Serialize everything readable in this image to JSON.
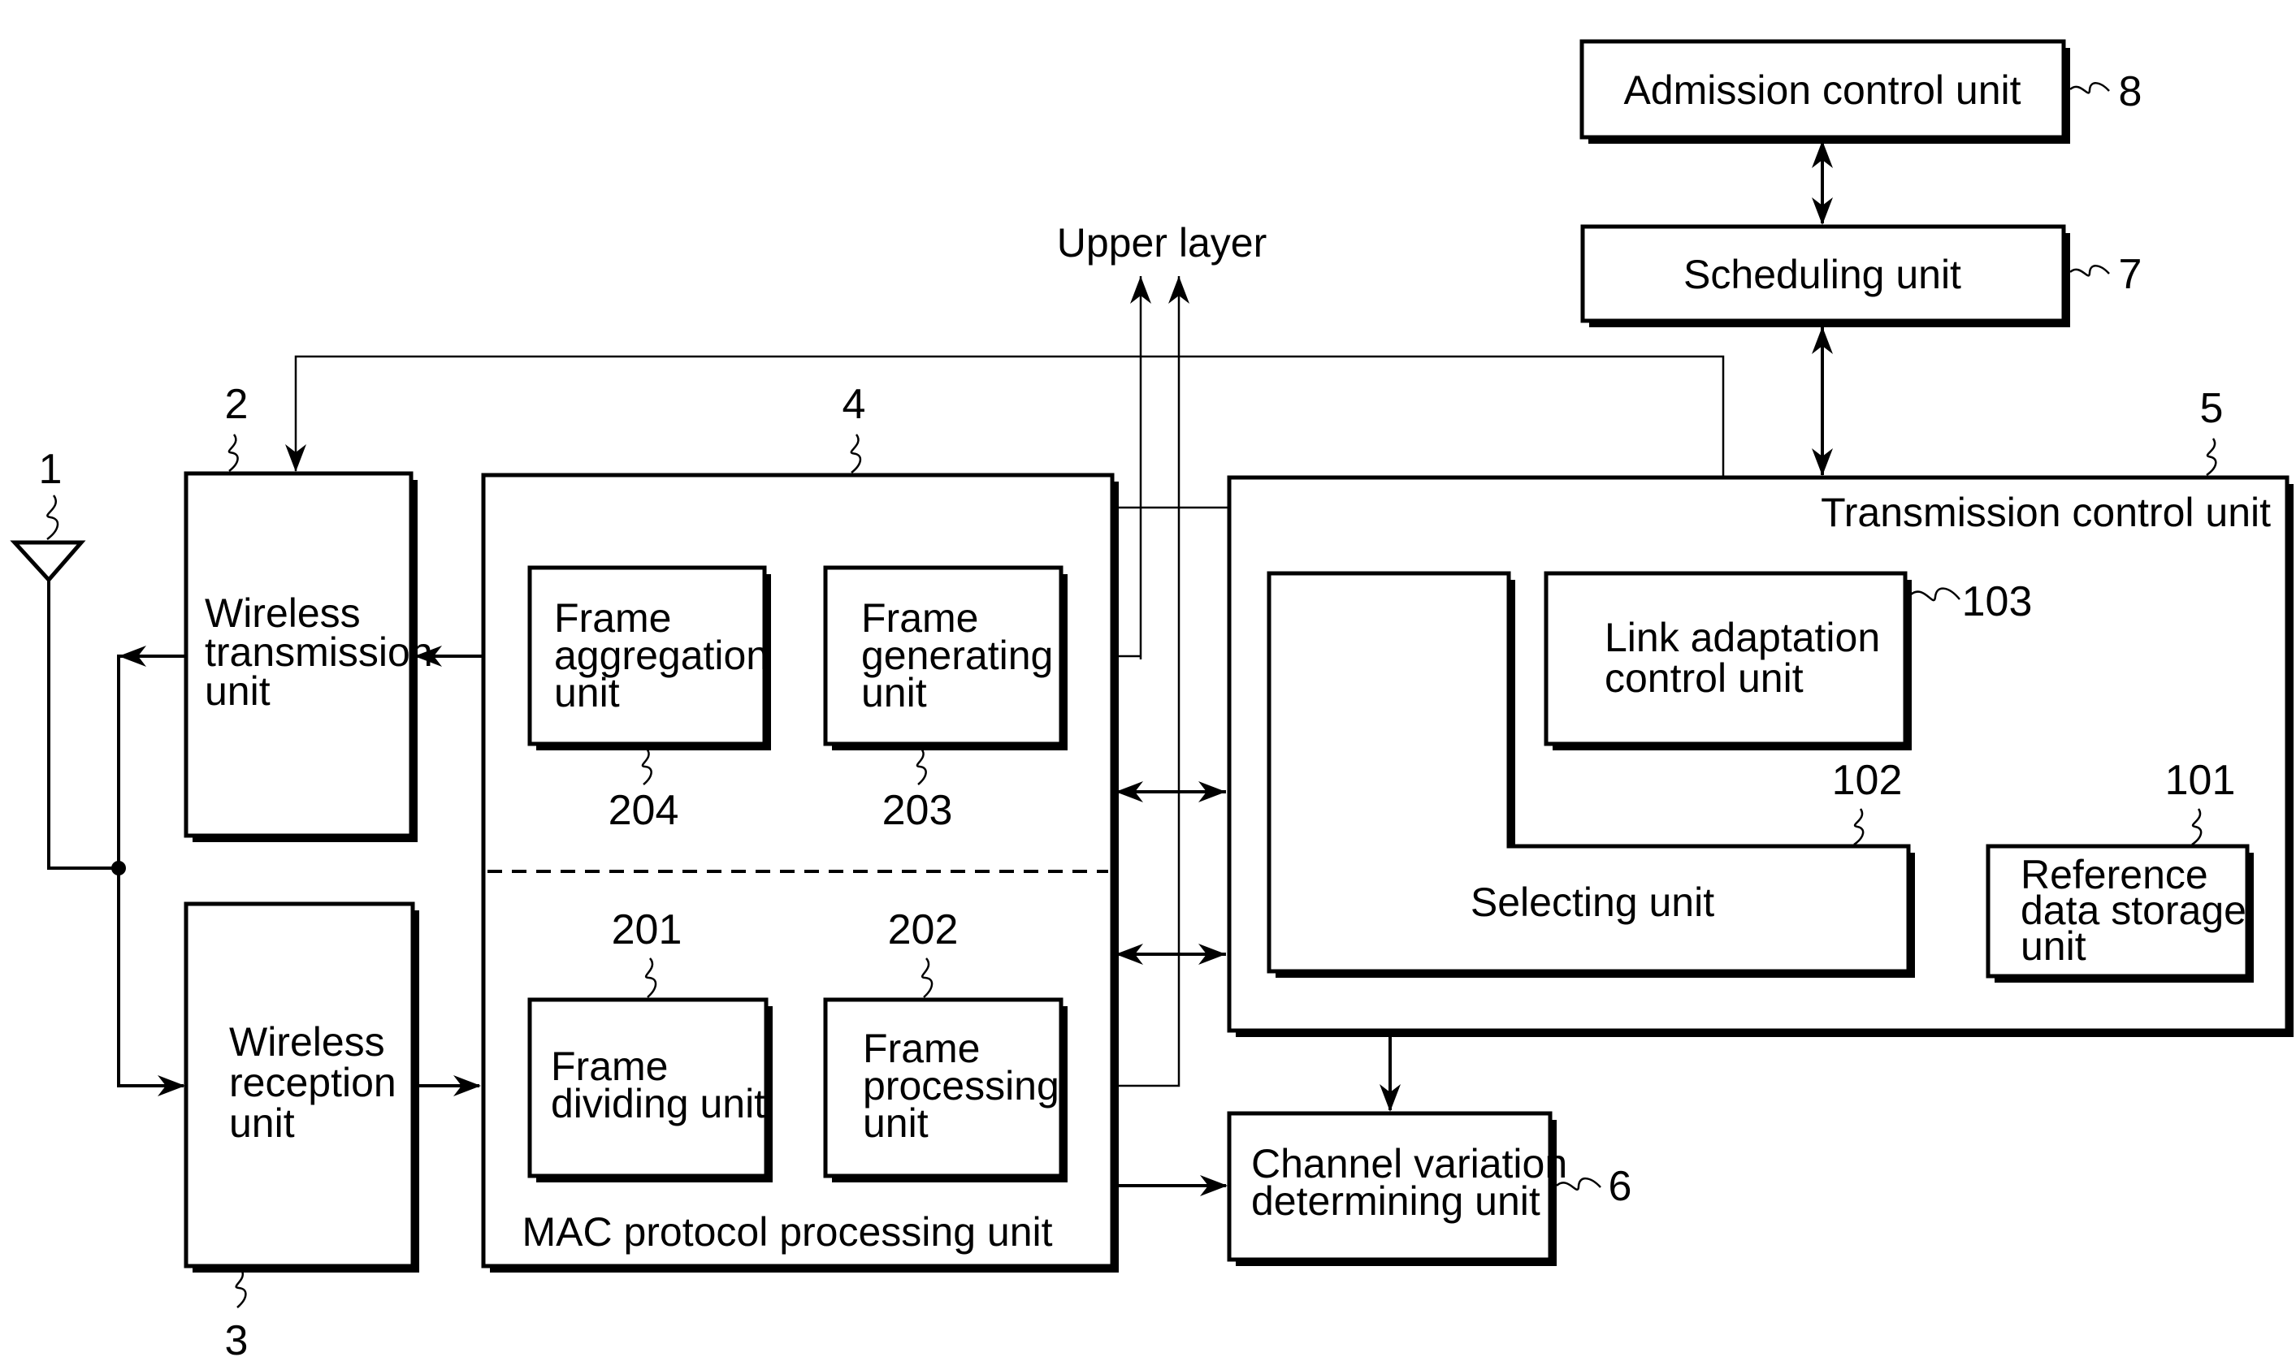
{
  "figure": {
    "upper_layer": "Upper layer",
    "blocks": {
      "admission": {
        "lines": [
          "Admission  control  unit"
        ],
        "ref": "8"
      },
      "scheduling": {
        "lines": [
          "Scheduling  unit"
        ],
        "ref": "7"
      },
      "wireless_tx": {
        "lines": [
          "Wireless",
          "transmission",
          "unit"
        ],
        "ref": "2"
      },
      "wireless_rx": {
        "lines": [
          "Wireless",
          "reception",
          "unit"
        ],
        "ref": "3"
      },
      "antenna": {
        "ref": "1"
      },
      "mac": {
        "lines": [
          "MAC  protocol  processing  unit"
        ],
        "ref": "4"
      },
      "frame_aggregation": {
        "lines": [
          "Frame",
          "aggregation",
          "unit"
        ],
        "ref": "204"
      },
      "frame_generating": {
        "lines": [
          "Frame",
          "generating",
          "unit"
        ],
        "ref": "203"
      },
      "frame_dividing": {
        "lines": [
          "Frame",
          "dividing  unit"
        ],
        "ref": "201"
      },
      "frame_processing": {
        "lines": [
          "Frame",
          "processing",
          "unit"
        ],
        "ref": "202"
      },
      "transmission_control": {
        "lines": [
          "Transmission  control  unit"
        ],
        "ref": "5"
      },
      "link_adaptation": {
        "lines": [
          "Link  adaptation",
          "control  unit"
        ],
        "ref": "103"
      },
      "selecting": {
        "lines": [
          "Selecting  unit"
        ],
        "ref": "102"
      },
      "reference_data": {
        "lines": [
          "Reference",
          "data  storage",
          "unit"
        ],
        "ref": "101"
      },
      "channel_variation": {
        "lines": [
          "Channel  variation",
          "determining  unit"
        ],
        "ref": "6"
      }
    }
  }
}
